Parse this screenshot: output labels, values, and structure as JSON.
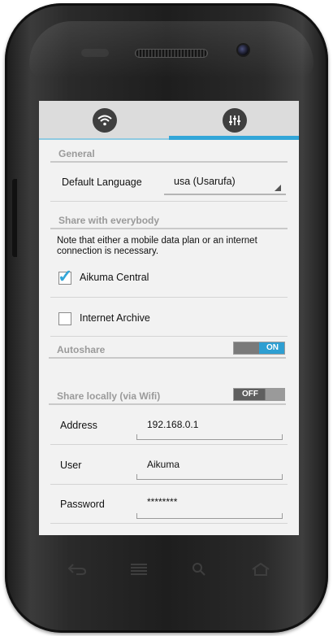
{
  "tabs": {
    "left_icon": "wifi-icon",
    "right_icon": "sliders-icon"
  },
  "general": {
    "header": "General",
    "language_label": "Default Language",
    "language_value": "usa (Usarufa)"
  },
  "share": {
    "header": "Share with everybody",
    "note": "Note that either a mobile data plan or an internet connection is necessary.",
    "aikuma_central": {
      "label": "Aikuma Central",
      "checked": true
    },
    "internet_archive": {
      "label": "Internet Archive",
      "checked": false
    }
  },
  "autoshare": {
    "label": "Autoshare",
    "toggle": "ON"
  },
  "share_locally": {
    "label": "Share locally (via Wifi)",
    "toggle": "OFF"
  },
  "fields": {
    "address_label": "Address",
    "address_value": "192.168.0.1",
    "user_label": "User",
    "user_value": "Aikuma",
    "password_label": "Password",
    "password_value": "********"
  },
  "colors": {
    "accent": "#33a6d8",
    "header_text": "#9a9a9a",
    "screen_bg": "#f2f2f2"
  }
}
